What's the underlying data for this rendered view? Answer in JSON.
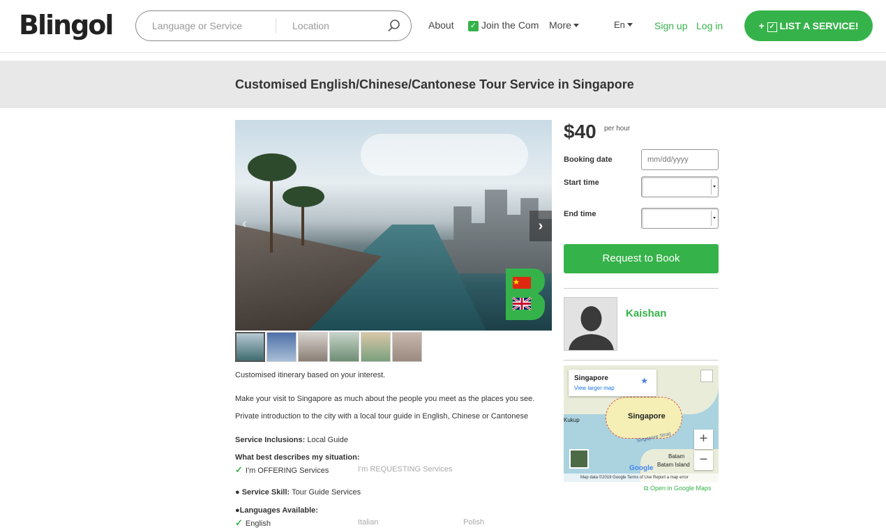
{
  "header": {
    "logo": "Blingol",
    "search": {
      "language_placeholder": "Language or Service",
      "location_placeholder": "Location"
    },
    "nav": {
      "about": "About",
      "join": "Join the Com",
      "more": "More",
      "lang": "En"
    },
    "sign_up": "Sign up",
    "log_in": "Log in",
    "list_service": "LIST A SERVICE!"
  },
  "title": "Customised English/Chinese/Cantonese Tour Service in Singapore",
  "booking": {
    "price": "$40",
    "per": "per hour",
    "booking_date_label": "Booking date",
    "date_placeholder": "mm/dd/yyyy",
    "start_time_label": "Start time",
    "end_time_label": "End time",
    "request_button": "Request to Book"
  },
  "host": {
    "name": "Kaishan"
  },
  "map": {
    "popup_title": "Singapore",
    "popup_link": "View larger map",
    "city_label": "Singapore",
    "strait_label": "Singapore Strait",
    "batam": "Batam",
    "batam_island": "Batam Island",
    "kukup": "Kukup",
    "footer": "Map data ©2019 Google   Terms of Use   Report a map error",
    "google": "Google",
    "open_link": "Open in Google Maps"
  },
  "description": {
    "p1": "Customised itinerary based on your interest.",
    "p2": "Make your visit to Singapore as much about the people you meet as the places you see.",
    "p3": "Private introduction to the city with a local tour guide in English, Chinese or Cantonese",
    "inclusions_label": "Service Inclusions:",
    "inclusions_value": "Local Guide",
    "situation_label": "What best describes my situation:",
    "offering": "I'm OFFERING Services",
    "requesting": "I'm REQUESTING Services",
    "skill_label": "Service Skill:",
    "skill_value": "Tour Guide Services",
    "languages_label": "Languages Available:",
    "languages": [
      "English",
      "Italian",
      "Polish"
    ]
  },
  "colors": {
    "brand_green": "#36b24a"
  }
}
